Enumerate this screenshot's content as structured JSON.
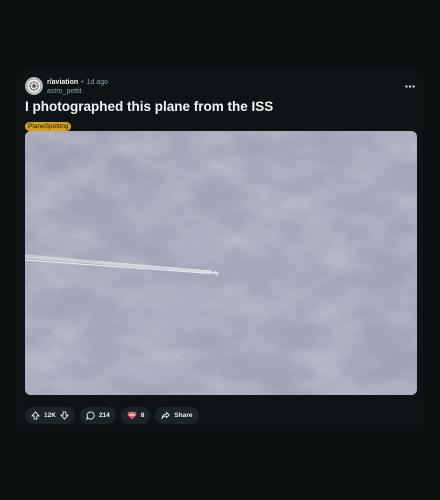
{
  "post": {
    "subreddit": "r/aviation",
    "separator": "•",
    "time_ago": "1d ago",
    "author": "astro_pettit",
    "title": "I photographed this plane from the ISS",
    "flair": "PlaneSpotting"
  },
  "media": {
    "alt_icon": "photo-of-clouds-with-plane-contrail"
  },
  "actions": {
    "votes": "12K",
    "comments": "214",
    "awards": "8",
    "share_label": "Share"
  },
  "colors": {
    "background": "#0b1011",
    "card": "#0e1416",
    "flair_bg": "#d6a01b",
    "pill_bg": "#1b2426",
    "muted_text": "#8ba2ad"
  },
  "icons": [
    "subreddit-avatar-icon",
    "more-options-icon",
    "upvote-icon",
    "downvote-icon",
    "comment-icon",
    "award-icon",
    "share-icon"
  ]
}
